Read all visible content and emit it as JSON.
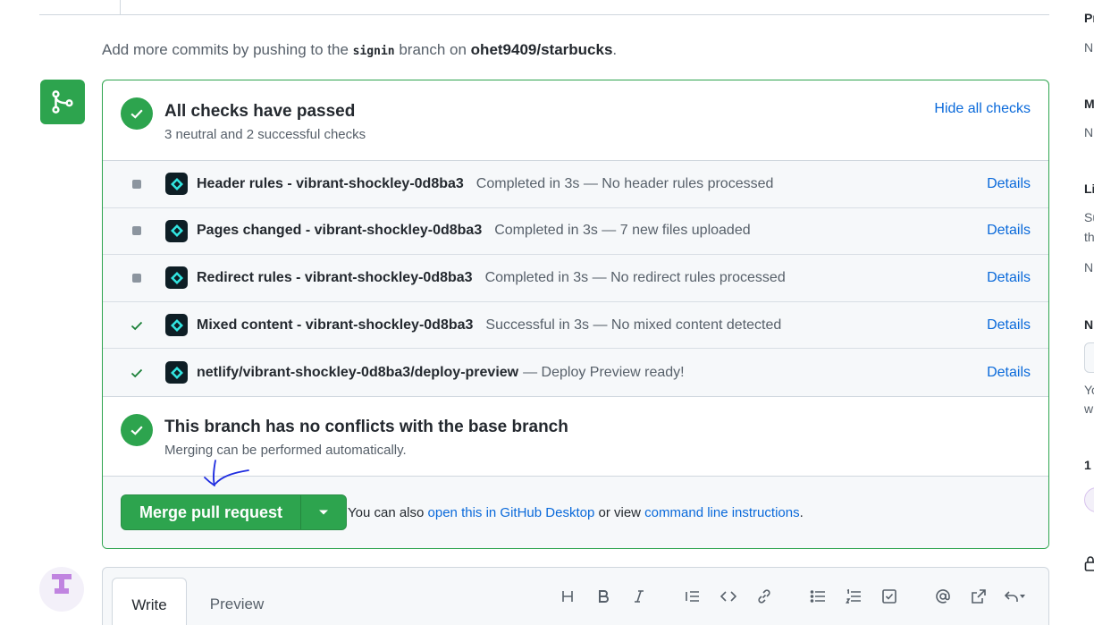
{
  "push_note": {
    "prefix": "Add more commits by pushing to the ",
    "branch": "signin",
    "middle": " branch on ",
    "repo": "ohet9409/starbucks",
    "suffix": "."
  },
  "checks_summary": {
    "title": "All checks have passed",
    "subtitle": "3 neutral and 2 successful checks",
    "hide_label": "Hide all checks"
  },
  "checks": [
    {
      "status": "neutral",
      "name": "Header rules - vibrant-shockley-0d8ba3",
      "description": "Completed in 3s — No header rules processed",
      "details": "Details"
    },
    {
      "status": "neutral",
      "name": "Pages changed - vibrant-shockley-0d8ba3",
      "description": "Completed in 3s — 7 new files uploaded",
      "details": "Details"
    },
    {
      "status": "neutral",
      "name": "Redirect rules - vibrant-shockley-0d8ba3",
      "description": "Completed in 3s — No redirect rules processed",
      "details": "Details"
    },
    {
      "status": "success",
      "name": "Mixed content - vibrant-shockley-0d8ba3",
      "description": "Successful in 3s — No mixed content detected",
      "details": "Details"
    },
    {
      "status": "success",
      "name": "netlify/vibrant-shockley-0d8ba3/deploy-preview",
      "description": "— Deploy Preview ready!",
      "details": "Details"
    }
  ],
  "conflicts": {
    "title": "This branch has no conflicts with the base branch",
    "subtitle": "Merging can be performed automatically."
  },
  "merge": {
    "button_label": "Merge pull request",
    "help_prefix": "You can also ",
    "help_link1": "open this in GitHub Desktop",
    "help_middle": " or view ",
    "help_link2": "command line instructions",
    "help_suffix": "."
  },
  "comment": {
    "tab_write": "Write",
    "tab_preview": "Preview",
    "toolbar": [
      "heading-icon",
      "bold-icon",
      "italic-icon",
      "quote-icon",
      "code-icon",
      "link-icon",
      "bullet-list-icon",
      "numbered-list-icon",
      "task-list-icon",
      "mention-icon",
      "cross-reference-icon",
      "saved-reply-icon"
    ]
  },
  "right_sidebar": [
    "Pr",
    "N",
    "M",
    "N",
    "Li",
    "Su",
    "th",
    "N",
    "N",
    "Yo",
    "w",
    "1"
  ],
  "colors": {
    "success": "#2da44e",
    "link": "#0969da",
    "neutral": "#8c959f",
    "annotation": "#1f2de0"
  }
}
